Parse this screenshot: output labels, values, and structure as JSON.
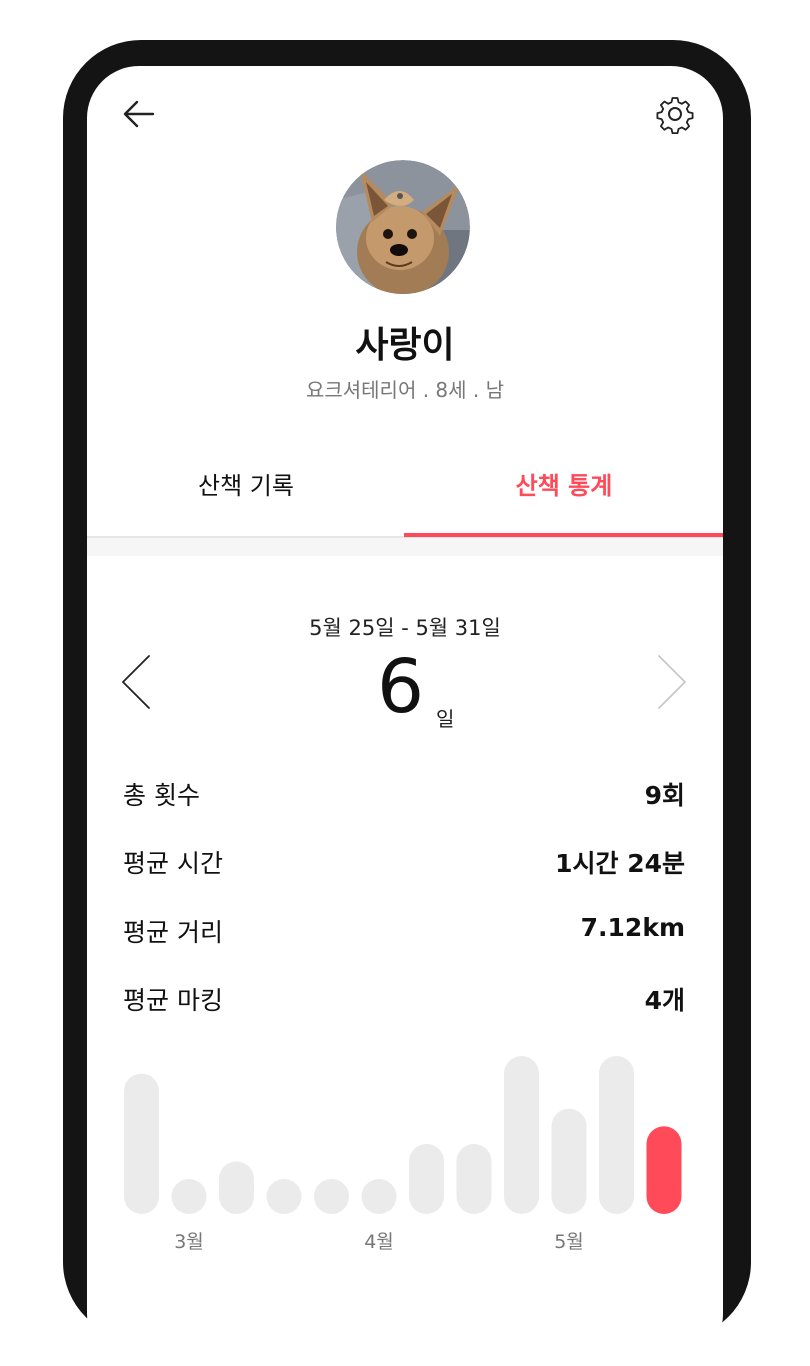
{
  "profile": {
    "name": "사랑이",
    "info": "요크셔테리어 . 8세 . 남"
  },
  "tabs": [
    {
      "label": "산책 기록",
      "active": false
    },
    {
      "label": "산책 통계",
      "active": true
    }
  ],
  "stats": {
    "date_range": "5월 25일 - 5월 31일",
    "days_value": "6",
    "days_unit": "일",
    "rows": [
      {
        "label": "총 횟수",
        "value": "9회"
      },
      {
        "label": "평균 시간",
        "value": "1시간 24분"
      },
      {
        "label": "평균 거리",
        "value": "7.12km"
      },
      {
        "label": "평균 마킹",
        "value": "4개"
      }
    ]
  },
  "colors": {
    "accent": "#ff4a5a",
    "bar_inactive": "#ebebeb",
    "text_muted": "#777777"
  },
  "icons": {
    "back": "arrow-left-icon",
    "settings": "gear-icon",
    "prev": "chevron-left-icon",
    "next": "chevron-right-icon"
  },
  "chart_data": {
    "type": "bar",
    "values": [
      4.0,
      1.0,
      1.5,
      1.0,
      1.0,
      1.0,
      2.0,
      2.0,
      4.5,
      3.0,
      4.5,
      2.5
    ],
    "highlight_index": 11,
    "tick_labels": [
      {
        "index": 1,
        "label": "3월"
      },
      {
        "index": 5,
        "label": "4월"
      },
      {
        "index": 9,
        "label": "5월"
      }
    ],
    "ylim": [
      0,
      4.5
    ]
  }
}
